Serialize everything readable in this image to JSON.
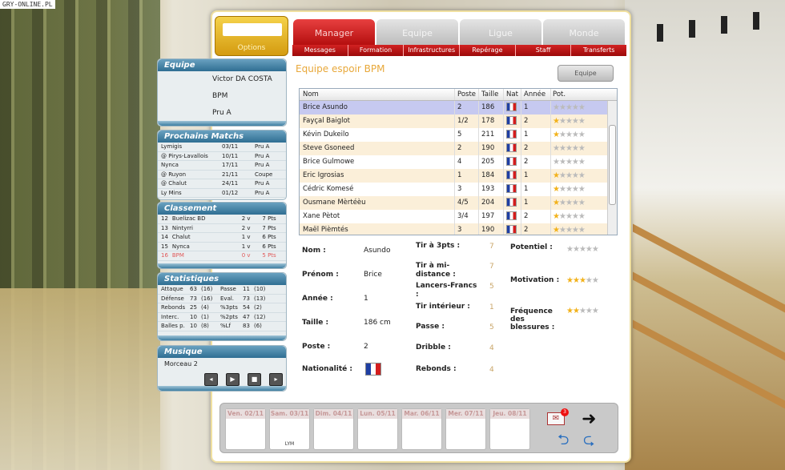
{
  "watermark": "GRY-ONLINE.PL",
  "options_label": "Options",
  "tabs": [
    "Manager",
    "Equipe",
    "Ligue",
    "Monde"
  ],
  "subtabs": [
    "Messages",
    "Formation",
    "Infrastructures",
    "Repérage",
    "Staff",
    "Transferts"
  ],
  "equipe": {
    "title": "Equipe",
    "manager": "Victor DA COSTA",
    "club": "BPM",
    "league": "Pru A"
  },
  "matches": {
    "title": "Prochains Matchs",
    "rows": [
      [
        "Lymigis",
        "03/11",
        "Pru A"
      ],
      [
        "@ Pirys-Lavallois",
        "10/11",
        "Pru A"
      ],
      [
        "Nynca",
        "17/11",
        "Pru A"
      ],
      [
        "@ Ruyon",
        "21/11",
        "Coupe"
      ],
      [
        "@ Chalut",
        "24/11",
        "Pru A"
      ],
      [
        "Ly Mins",
        "01/12",
        "Pru A"
      ]
    ]
  },
  "classement": {
    "title": "Classement",
    "rows": [
      [
        "12",
        "Buelizac BD",
        "2 v",
        "7 Pts"
      ],
      [
        "13",
        "Nintyrri",
        "2 v",
        "7 Pts"
      ],
      [
        "14",
        "Chalut",
        "1 v",
        "6 Pts"
      ],
      [
        "15",
        "Nynca",
        "1 v",
        "6 Pts"
      ],
      [
        "16",
        "BPM",
        "0 v",
        "5 Pts"
      ]
    ]
  },
  "statistiques": {
    "title": "Statistiques",
    "rows": [
      [
        "Attaque",
        "63",
        "(16)",
        "Passe",
        "11",
        "(10)"
      ],
      [
        "Défense",
        "73",
        "(16)",
        "Eval.",
        "73",
        "(13)"
      ],
      [
        "Rebonds",
        "25",
        "(4)",
        "%3pts",
        "54",
        "(2)"
      ],
      [
        "Interc.",
        "10",
        "(1)",
        "%2pts",
        "47",
        "(12)"
      ],
      [
        "Balles p.",
        "10",
        "(8)",
        "%Lf",
        "83",
        "(6)"
      ]
    ]
  },
  "musique": {
    "title": "Musique",
    "track": "Morceau 2",
    "buttons": [
      "prev-icon",
      "play-icon",
      "stop-icon",
      "next-icon"
    ]
  },
  "team_title": "Equipe espoir BPM",
  "equipe_button": "Equipe",
  "roster": {
    "headers": [
      "Nom",
      "Poste",
      "Taille",
      "Nat",
      "Année",
      "Pot."
    ],
    "rows": [
      {
        "nom": "Brice Asundo",
        "poste": "2",
        "taille": "186",
        "annee": "1",
        "pot": 0
      },
      {
        "nom": "Fayçal Baiglot",
        "poste": "1/2",
        "taille": "178",
        "annee": "2",
        "pot": 1
      },
      {
        "nom": "Kévin Dukeilo",
        "poste": "5",
        "taille": "211",
        "annee": "1",
        "pot": 1
      },
      {
        "nom": "Steve Gsoneed",
        "poste": "2",
        "taille": "190",
        "annee": "2",
        "pot": 0
      },
      {
        "nom": "Brice Gulmowe",
        "poste": "4",
        "taille": "205",
        "annee": "2",
        "pot": 0
      },
      {
        "nom": "Eric Igrosias",
        "poste": "1",
        "taille": "184",
        "annee": "1",
        "pot": 1
      },
      {
        "nom": "Cédric Komesé",
        "poste": "3",
        "taille": "193",
        "annee": "1",
        "pot": 1
      },
      {
        "nom": "Ousmane Mèrtéèu",
        "poste": "4/5",
        "taille": "204",
        "annee": "1",
        "pot": 1
      },
      {
        "nom": "Xane Pètot",
        "poste": "3/4",
        "taille": "197",
        "annee": "2",
        "pot": 1
      },
      {
        "nom": "Maël Pièmtés",
        "poste": "3",
        "taille": "190",
        "annee": "2",
        "pot": 1
      }
    ]
  },
  "player": {
    "nom_label": "Nom :",
    "nom": "Asundo",
    "prenom_label": "Prénom :",
    "prenom": "Brice",
    "annee_label": "Année :",
    "annee": "1",
    "taille_label": "Taille :",
    "taille": "186 cm",
    "poste_label": "Poste :",
    "poste": "2",
    "nat_label": "Nationalité :",
    "skills": [
      {
        "label": "Tir à 3pts :",
        "value": "7"
      },
      {
        "label": "Tir à mi-distance :",
        "value": "7"
      },
      {
        "label": "Lancers-Francs :",
        "value": "5"
      },
      {
        "label": "Tir intérieur :",
        "value": "1"
      },
      {
        "label": "Passe :",
        "value": "5"
      },
      {
        "label": "Dribble :",
        "value": "4"
      },
      {
        "label": "Rebonds :",
        "value": "4"
      }
    ],
    "potentiel_label": "Potentiel :",
    "potentiel": 0,
    "motivation_label": "Motivation :",
    "motivation": 3,
    "blessures_label": "Fréquence des blessures :",
    "blessures": 2
  },
  "calendar": [
    {
      "day": "Ven. 02/11",
      "event": ""
    },
    {
      "day": "Sam. 03/11",
      "event": "LYM"
    },
    {
      "day": "Dim. 04/11",
      "event": ""
    },
    {
      "day": "Lun. 05/11",
      "event": ""
    },
    {
      "day": "Mar. 06/11",
      "event": ""
    },
    {
      "day": "Mer. 07/11",
      "event": ""
    },
    {
      "day": "Jeu. 08/11",
      "event": ""
    }
  ],
  "mail_count": "3",
  "colors": {
    "accent_red": "#c81818",
    "header_blue": "#3a7da3",
    "gold": "#e0a93a",
    "selected_row": "#c6c9f0"
  }
}
